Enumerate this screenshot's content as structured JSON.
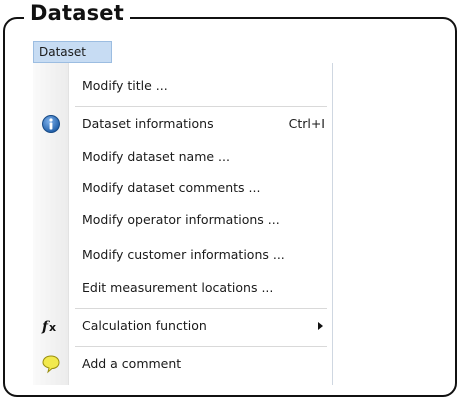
{
  "frame": {
    "title": "Dataset"
  },
  "menubar": {
    "active_menu": "Dataset"
  },
  "menu": {
    "items": [
      {
        "label": "Modify title ...",
        "icon": ""
      },
      {
        "label": "Dataset informations",
        "shortcut": "Ctrl+I",
        "icon": "info-icon"
      },
      {
        "label": "Modify dataset name ...",
        "icon": ""
      },
      {
        "label": "Modify dataset comments ...",
        "icon": ""
      },
      {
        "label": "Modify operator informations ...",
        "icon": ""
      },
      {
        "label": "Modify customer informations ...",
        "icon": ""
      },
      {
        "label": "Edit measurement locations ...",
        "icon": ""
      },
      {
        "label": "Calculation function",
        "icon": "function-icon",
        "has_submenu": true
      },
      {
        "label": "Add a comment",
        "icon": "comment-bubble-icon"
      }
    ]
  },
  "colors": {
    "menubar_highlight": "#c7dcf3",
    "info_icon": "#2f6fb8",
    "comment_icon": "#f2e94e"
  }
}
